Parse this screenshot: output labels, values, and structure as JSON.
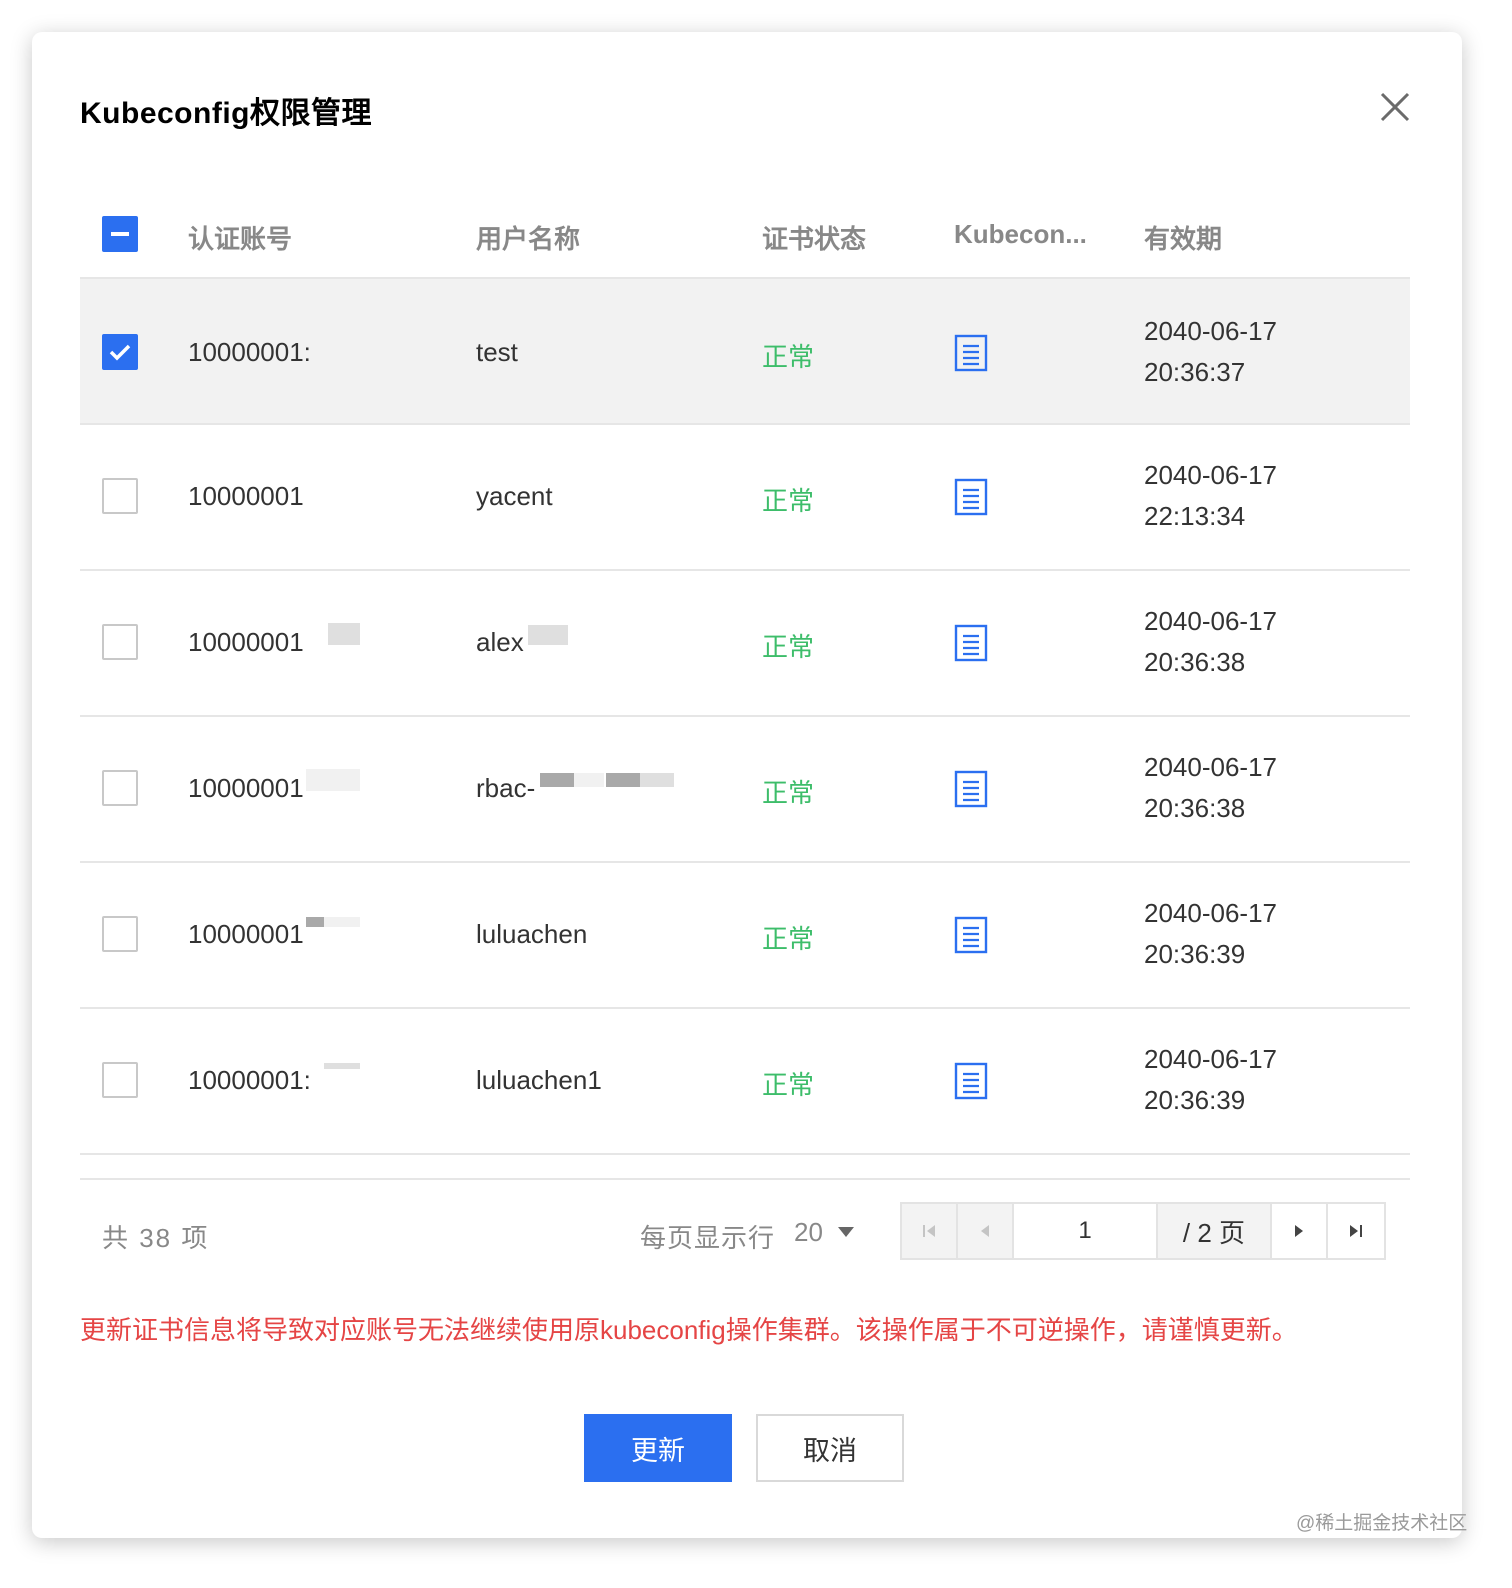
{
  "dialog": {
    "title": "Kubeconfig权限管理",
    "close_icon": "close-icon"
  },
  "table": {
    "headers": [
      "认证账号",
      "用户名称",
      "证书状态",
      "Kubecon...",
      "有效期"
    ],
    "select_all_state": "indeterminate",
    "rows": [
      {
        "account": "10000001:",
        "username": "test",
        "status": "正常",
        "kubeconfig_icon": "document-icon",
        "expiry_date": "2040-06-17",
        "expiry_time": "20:36:37",
        "checked": true
      },
      {
        "account": "10000001",
        "username": "yacent",
        "status": "正常",
        "kubeconfig_icon": "document-icon",
        "expiry_date": "2040-06-17",
        "expiry_time": "22:13:34",
        "checked": false
      },
      {
        "account": "10000001",
        "username": "alex",
        "status": "正常",
        "kubeconfig_icon": "document-icon",
        "expiry_date": "2040-06-17",
        "expiry_time": "20:36:38",
        "checked": false
      },
      {
        "account": "10000001",
        "username": "rbac-",
        "status": "正常",
        "kubeconfig_icon": "document-icon",
        "expiry_date": "2040-06-17",
        "expiry_time": "20:36:38",
        "checked": false
      },
      {
        "account": "10000001",
        "username": "luluachen",
        "status": "正常",
        "kubeconfig_icon": "document-icon",
        "expiry_date": "2040-06-17",
        "expiry_time": "20:36:39",
        "checked": false
      },
      {
        "account": "10000001:",
        "username": "luluachen1",
        "status": "正常",
        "kubeconfig_icon": "document-icon",
        "expiry_date": "2040-06-17",
        "expiry_time": "20:36:39",
        "checked": false
      }
    ]
  },
  "pagination": {
    "total_text": "共 38 项",
    "page_size_label": "每页显示行",
    "page_size": "20",
    "current_page": "1",
    "total_pages_text": "/ 2 页"
  },
  "warning": "更新证书信息将导致对应账号无法继续使用原kubeconfig操作集群。该操作属于不可逆操作，请谨慎更新。",
  "buttons": {
    "update": "更新",
    "cancel": "取消"
  },
  "watermark": "@稀土掘金技术社区",
  "colors": {
    "primary": "#2b6ff0",
    "status_ok": "#3dbd6a",
    "warning": "#e54545",
    "selected_row": "#f2f2f2"
  }
}
